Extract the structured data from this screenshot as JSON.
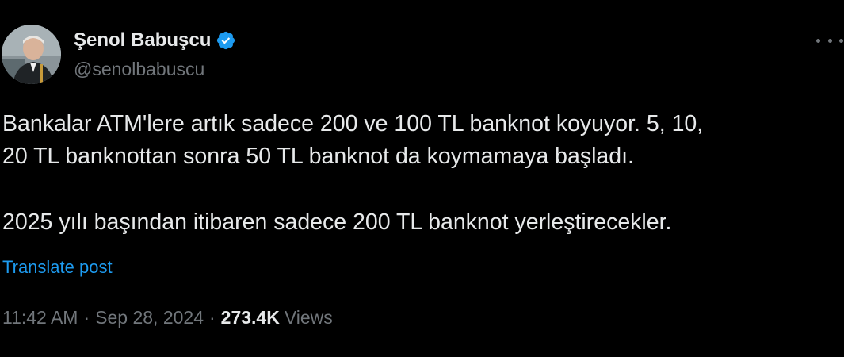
{
  "author": {
    "display_name": "Şenol Babuşcu",
    "handle": "@senolbabuscu",
    "verified_icon": "verified-badge-icon",
    "avatar_icon": "profile-avatar"
  },
  "menu": {
    "more_icon": "more-options-icon"
  },
  "tweet": {
    "line1": "Bankalar ATM'lere artık sadece 200 ve 100 TL banknot koyuyor.  5, 10,",
    "line2": "20 TL banknottan sonra 50 TL banknot da koymamaya başladı.",
    "line3": "2025 yılı başından itibaren sadece 200 TL banknot yerleştirecekler.",
    "translate_label": "Translate post"
  },
  "meta": {
    "time": "11:42 AM",
    "separator": "·",
    "date": "Sep 28, 2024",
    "views_count": "273.4K",
    "views_label": "Views"
  },
  "colors": {
    "background": "#000000",
    "text": "#e7e9ea",
    "secondary": "#71767b",
    "accent": "#1d9bf0"
  }
}
